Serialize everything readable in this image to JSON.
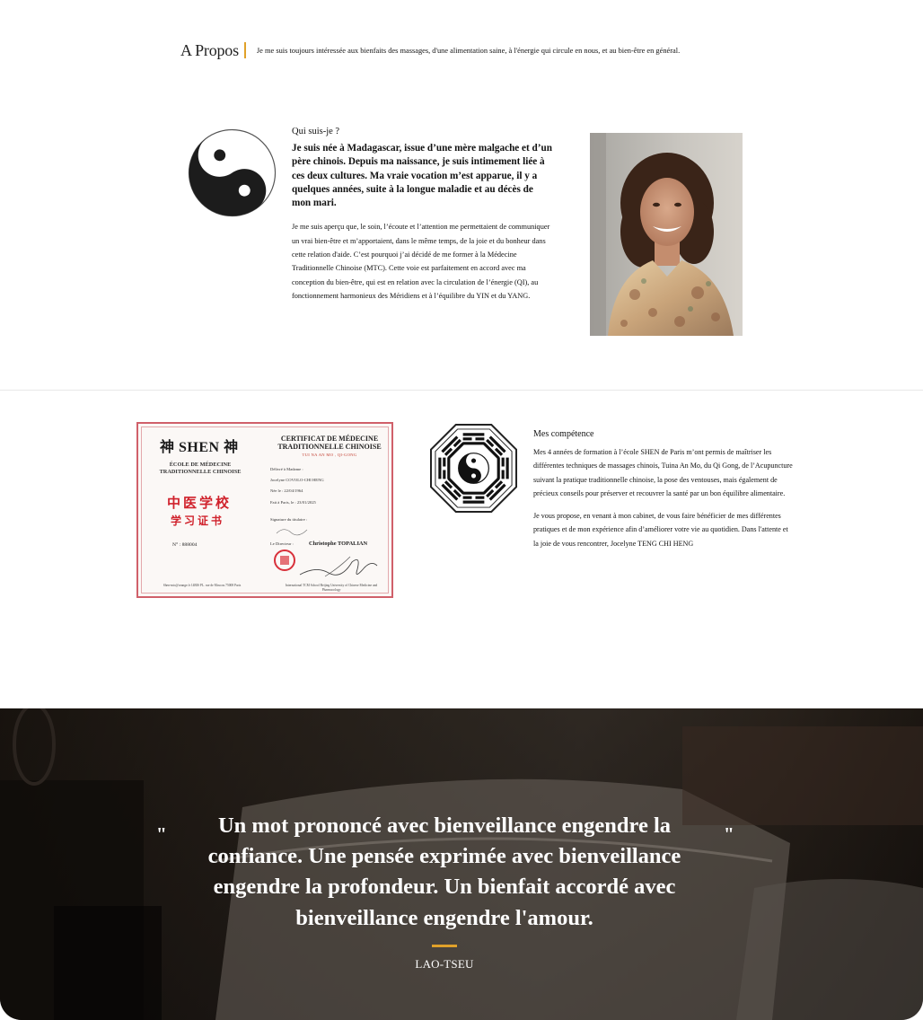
{
  "apropos": {
    "title": "A Propos",
    "tagline": "Je me suis toujours intéressée aux bienfaits des massages, d'une alimentation saine, à l'énergie qui circule en nous, et au bien-être en général."
  },
  "about": {
    "heading": "Qui suis-je ?",
    "lead": "Je suis née à Madagascar, issue d’une mère malgache et d’un père chinois. Depuis ma naissance, je suis intimement liée à ces deux cultures. Ma vraie vocation m’est apparue, il y a quelques années, suite à la longue maladie et au décès de mon mari.",
    "body": "Je me suis aperçu que, le soin, l’écoute et l’attention me permettaient de communiquer un vrai bien-être et m’apportaient, dans le même temps, de la joie et du bonheur dans cette relation d'aide. C’est pourquoi j’ai décidé de me former à la Médecine Traditionnelle Chinoise (MTC). Cette voie est parfaitement en accord avec ma conception du bien-être, qui est en relation avec la circulation de l’énergie (QI), au fonctionnement harmonieux des Méridiens et à l’équilibre du YIN et du YANG."
  },
  "certificate": {
    "brand": "神 SHEN 神",
    "school": "ÉCOLE DE MÉDECINE TRADITIONNELLE CHINOISE",
    "cn_line1": "中医学校",
    "cn_line2": "学习证书",
    "number": "N° : 888004",
    "title": "CERTIFICAT DE MÉDECINE TRADITIONNELLE CHINOISE",
    "subtitle": "TUI NA AN MO , QI-GONG",
    "delivered_to": "Délivré à Madame :",
    "name": "Jocelyne COVOLO-CHI HENG",
    "born": "Née le : 22/04/1964",
    "done": "Fait à Paris, le : 23/01/2025",
    "signature_label": "Signature du titulaire :",
    "director_label": "Le Directeur :",
    "director": "Christophe TOPALIAN",
    "footer_left": "Shen-mtc@orange.fr 14BIS PL. rue de Moscou 75008 Paris",
    "footer_right": "International TCM School Beijing University of Chinese Medicine and Pharmacology"
  },
  "skills": {
    "heading": "Mes compétence",
    "p1": "Mes 4 années de formation à l’école SHEN de Paris m’ont permis de maîtriser les différentes techniques de massages chinois, Tuina An Mo, du Qi Gong, de l’Acupuncture suivant la pratique traditionnelle chinoise, la pose des ventouses, mais également de précieux conseils pour préserver et recouvrer la santé par un bon équilibre alimentaire.",
    "p2": "Je vous propose, en venant à mon cabinet, de vous faire bénéficier de mes différentes pratiques et de mon expérience afin d’améliorer votre vie au quotidien. Dans l'attente et la joie de vous rencontrer, Jocelyne TENG CHI HENG"
  },
  "quote": {
    "open_mark": "\"",
    "close_mark": "\"",
    "text": "Un mot prononcé avec bienveillance engendre la confiance. Une pensée exprimée avec bienveillance engendre la profondeur. Un bienfait accordé avec bienveillance engendre l'amour.",
    "author": "LAO-TSEU"
  },
  "colors": {
    "accent": "#e0a12a",
    "certificate_red": "#d0222c"
  }
}
